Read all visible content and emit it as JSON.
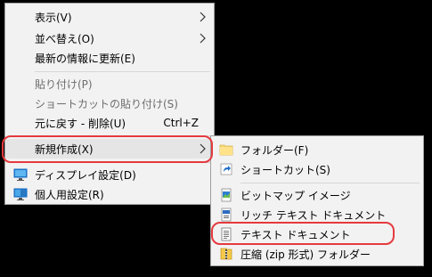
{
  "main_menu": {
    "items": [
      {
        "label": "表示(V)"
      },
      {
        "label": "並べ替え(O)"
      },
      {
        "label": "最新の情報に更新(E)"
      },
      {
        "label": "貼り付け(P)"
      },
      {
        "label": "ショートカットの貼り付け(S)"
      },
      {
        "label": "元に戻す - 削除(U)",
        "shortcut": "Ctrl+Z"
      },
      {
        "label": "新規作成(X)"
      },
      {
        "label": "ディスプレイ設定(D)",
        "icon": "display-icon"
      },
      {
        "label": "個人用設定(R)",
        "icon": "personalize-icon"
      }
    ]
  },
  "sub_menu": {
    "items": [
      {
        "label": "フォルダー(F)",
        "icon": "folder-icon"
      },
      {
        "label": "ショートカット(S)",
        "icon": "shortcut-icon"
      },
      {
        "label": "ビットマップ イメージ",
        "icon": "bitmap-icon"
      },
      {
        "label": "リッチ テキスト ドキュメント",
        "icon": "rich-text-icon"
      },
      {
        "label": "テキスト ドキュメント",
        "icon": "text-document-icon"
      },
      {
        "label": "圧縮 (zip 形式) フォルダー",
        "icon": "zip-folder-icon"
      }
    ]
  },
  "colors": {
    "highlight": "#e53a3f",
    "menu_bg": "#f2f2f2",
    "disabled_text": "#6d6d6d"
  }
}
